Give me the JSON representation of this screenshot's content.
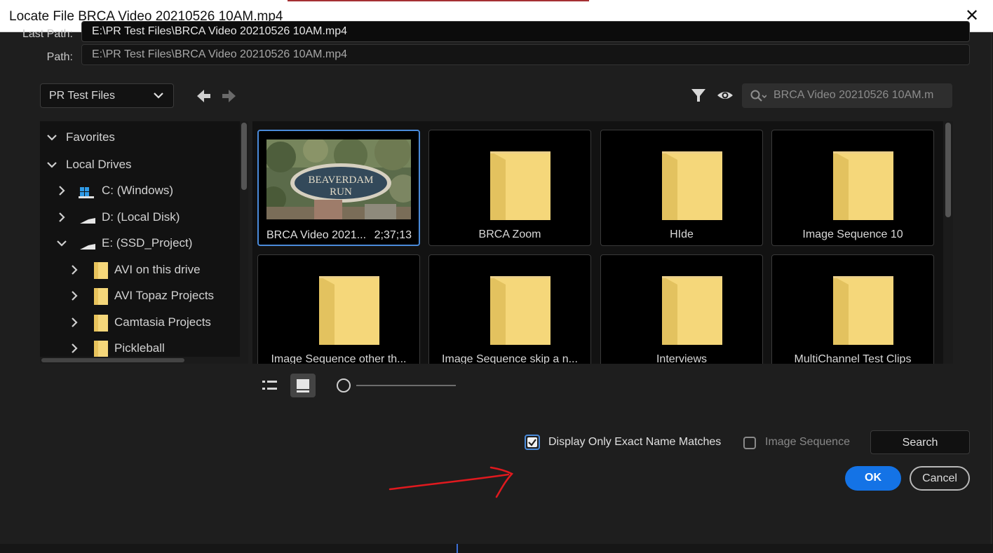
{
  "window": {
    "title": "Locate File BRCA Video 20210526 10AM.mp4",
    "close_glyph": "✕"
  },
  "paths": {
    "last_path_label": "Last Path:",
    "last_path_value": "E:\\PR Test Files\\BRCA Video 20210526 10AM.mp4",
    "path_label": "Path:",
    "path_value": "E:\\PR Test Files\\BRCA Video 20210526 10AM.mp4"
  },
  "toolbar": {
    "location": "PR Test Files",
    "search_value": "BRCA Video 20210526 10AM.m",
    "icons": [
      "chevron-down-icon",
      "back-arrow-icon",
      "forward-arrow-icon",
      "filter-icon",
      "eye-icon",
      "search-icon"
    ]
  },
  "tree": {
    "items": [
      {
        "label": "Favorites",
        "expanded": true,
        "icon": "none"
      },
      {
        "label": "Local Drives",
        "expanded": true,
        "icon": "none"
      },
      {
        "label": "C: (Windows)",
        "expanded": false,
        "icon": "windows-drive-icon"
      },
      {
        "label": "D: (Local Disk)",
        "expanded": false,
        "icon": "drive-icon"
      },
      {
        "label": "E: (SSD_Project)",
        "expanded": true,
        "icon": "drive-icon"
      },
      {
        "label": "AVI on this drive",
        "expanded": false,
        "icon": "folder-icon"
      },
      {
        "label": "AVI Topaz Projects",
        "expanded": false,
        "icon": "folder-icon"
      },
      {
        "label": "Camtasia Projects",
        "expanded": false,
        "icon": "folder-icon"
      },
      {
        "label": "Pickleball",
        "expanded": false,
        "icon": "folder-icon"
      }
    ]
  },
  "grid": {
    "video": {
      "name": "BRCA Video 2021...",
      "duration": "2;37;13",
      "sign_text_line1": "BEAVERDAM",
      "sign_text_line2": "RUN"
    },
    "folders": [
      "BRCA Zoom",
      "HIde",
      "Image Sequence 10",
      "Image Sequence other th...",
      "Image Sequence skip a n...",
      "Interviews",
      "MultiChannel Test Clips"
    ]
  },
  "options": {
    "exact_match_label": "Display Only Exact Name Matches",
    "exact_match_checked": true,
    "image_sequence_label": "Image Sequence",
    "image_sequence_checked": false
  },
  "buttons": {
    "search": "Search",
    "ok": "OK",
    "cancel": "Cancel"
  },
  "colors": {
    "accent": "#1473e6",
    "selection": "#4a8ad9",
    "folder": "#f5d77a",
    "annotation": "#e0191e"
  }
}
